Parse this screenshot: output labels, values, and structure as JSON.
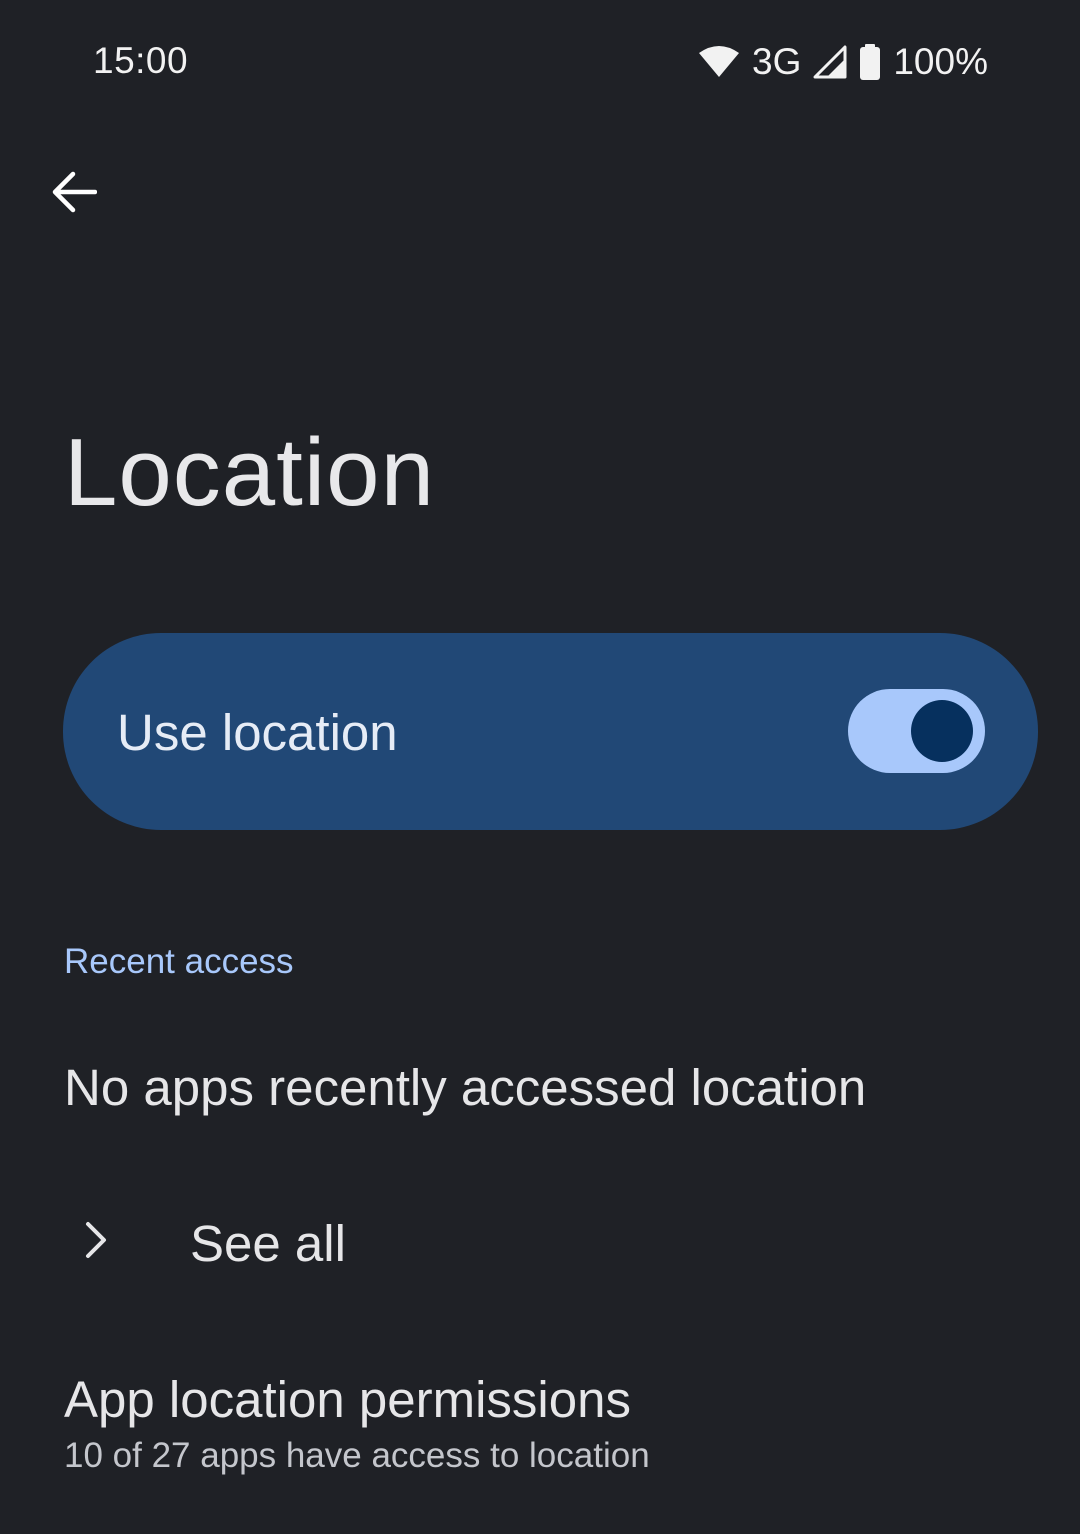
{
  "status_bar": {
    "time": "15:00",
    "network": "3G",
    "battery": "100%",
    "icons": [
      "wifi-icon",
      "cell-signal-icon",
      "battery-icon"
    ]
  },
  "toolbar": {
    "back_icon": "arrow-back-icon"
  },
  "page": {
    "title": "Location"
  },
  "use_location": {
    "label": "Use location",
    "enabled": true
  },
  "recent_access": {
    "header": "Recent access",
    "empty_text": "No apps recently accessed location",
    "see_all": "See all"
  },
  "app_permissions": {
    "title": "App location permissions",
    "summary": "10 of 27 apps have access to location"
  },
  "colors": {
    "background": "#1f2126",
    "card": "#214876",
    "accent": "#a8c8fb",
    "toggle_thumb": "#06305e"
  }
}
